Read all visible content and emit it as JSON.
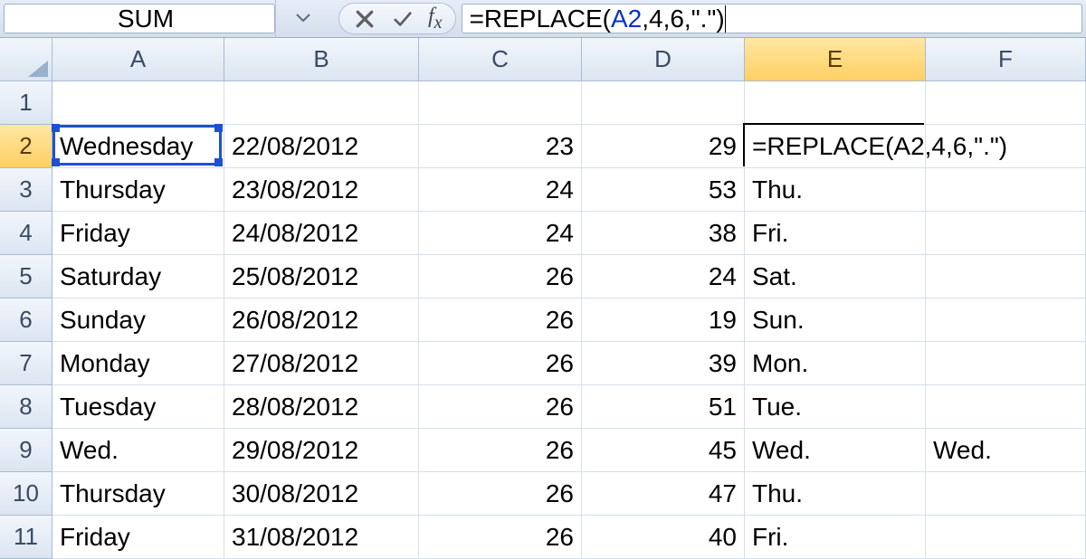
{
  "namebox": {
    "value": "SUM"
  },
  "formula_bar": {
    "prefix": "=REPLACE(",
    "ref": "A2",
    "suffix": ",4,6,\".\")"
  },
  "columns": [
    "A",
    "B",
    "C",
    "D",
    "E",
    "F"
  ],
  "active_column": "E",
  "active_row": "2",
  "chart_data": {
    "type": "table",
    "title": "",
    "columns": [
      "Row",
      "A",
      "B",
      "C",
      "D",
      "E",
      "F"
    ],
    "rows": [
      {
        "r": "1",
        "A": "",
        "B": "",
        "C": "",
        "D": "",
        "E": "",
        "F": ""
      },
      {
        "r": "2",
        "A": "Wednesday",
        "B": "22/08/2012",
        "C": "23",
        "D": "29",
        "E": "=REPLACE(A2,4,6,\".\")",
        "F": ""
      },
      {
        "r": "3",
        "A": "Thursday",
        "B": "23/08/2012",
        "C": "24",
        "D": "53",
        "E": "Thu.",
        "F": ""
      },
      {
        "r": "4",
        "A": "Friday",
        "B": "24/08/2012",
        "C": "24",
        "D": "38",
        "E": "Fri.",
        "F": ""
      },
      {
        "r": "5",
        "A": "Saturday",
        "B": "25/08/2012",
        "C": "26",
        "D": "24",
        "E": "Sat.",
        "F": ""
      },
      {
        "r": "6",
        "A": "Sunday",
        "B": "26/08/2012",
        "C": "26",
        "D": "19",
        "E": "Sun.",
        "F": ""
      },
      {
        "r": "7",
        "A": "Monday",
        "B": "27/08/2012",
        "C": "26",
        "D": "39",
        "E": "Mon.",
        "F": ""
      },
      {
        "r": "8",
        "A": "Tuesday",
        "B": "28/08/2012",
        "C": "26",
        "D": "51",
        "E": "Tue.",
        "F": ""
      },
      {
        "r": "9",
        "A": "Wed.",
        "B": "29/08/2012",
        "C": "26",
        "D": "45",
        "E": "Wed.",
        "F": "Wed."
      },
      {
        "r": "10",
        "A": "Thursday",
        "B": "30/08/2012",
        "C": "26",
        "D": "47",
        "E": "Thu.",
        "F": ""
      },
      {
        "r": "11",
        "A": "Friday",
        "B": "31/08/2012",
        "C": "26",
        "D": "40",
        "E": "Fri.",
        "F": ""
      }
    ]
  },
  "colors": {
    "ref_blue": "#1e4fd6",
    "header_active": "#ffcf63"
  }
}
